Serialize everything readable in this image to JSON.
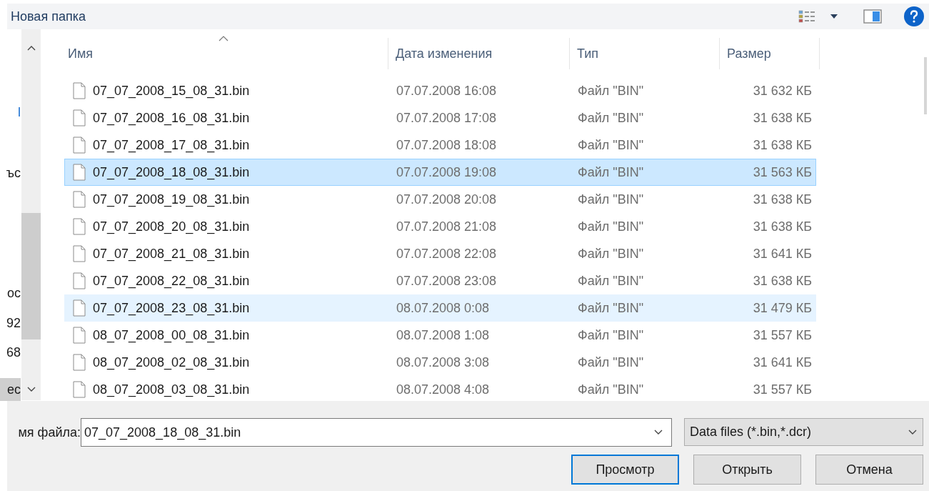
{
  "toolbar": {
    "new_folder": "Новая папка"
  },
  "nav_items": [
    {
      "label": "l",
      "kind": "link",
      "selected": false
    },
    {
      "label": "ъс",
      "kind": "text",
      "selected": false
    },
    {
      "label": "ос",
      "kind": "text",
      "selected": false
    },
    {
      "label": "92",
      "kind": "text",
      "selected": false
    },
    {
      "label": "68",
      "kind": "text",
      "selected": false
    },
    {
      "label": "ес",
      "kind": "text",
      "selected": true
    }
  ],
  "columns": [
    "Имя",
    "Дата изменения",
    "Тип",
    "Размер"
  ],
  "rows": [
    {
      "name": "07_07_2008_15_08_31.bin",
      "date": "07.07.2008 16:08",
      "type": "Файл \"BIN\"",
      "size": "31 632 КБ",
      "selected": false,
      "hovered": false
    },
    {
      "name": "07_07_2008_16_08_31.bin",
      "date": "07.07.2008 17:08",
      "type": "Файл \"BIN\"",
      "size": "31 638 КБ",
      "selected": false,
      "hovered": false
    },
    {
      "name": "07_07_2008_17_08_31.bin",
      "date": "07.07.2008 18:08",
      "type": "Файл \"BIN\"",
      "size": "31 638 КБ",
      "selected": false,
      "hovered": false
    },
    {
      "name": "07_07_2008_18_08_31.bin",
      "date": "07.07.2008 19:08",
      "type": "Файл \"BIN\"",
      "size": "31 563 КБ",
      "selected": true,
      "hovered": false
    },
    {
      "name": "07_07_2008_19_08_31.bin",
      "date": "07.07.2008 20:08",
      "type": "Файл \"BIN\"",
      "size": "31 638 КБ",
      "selected": false,
      "hovered": false
    },
    {
      "name": "07_07_2008_20_08_31.bin",
      "date": "07.07.2008 21:08",
      "type": "Файл \"BIN\"",
      "size": "31 638 КБ",
      "selected": false,
      "hovered": false
    },
    {
      "name": "07_07_2008_21_08_31.bin",
      "date": "07.07.2008 22:08",
      "type": "Файл \"BIN\"",
      "size": "31 641 КБ",
      "selected": false,
      "hovered": false
    },
    {
      "name": "07_07_2008_22_08_31.bin",
      "date": "07.07.2008 23:08",
      "type": "Файл \"BIN\"",
      "size": "31 638 КБ",
      "selected": false,
      "hovered": false
    },
    {
      "name": "07_07_2008_23_08_31.bin",
      "date": "08.07.2008 0:08",
      "type": "Файл \"BIN\"",
      "size": "31 479 КБ",
      "selected": false,
      "hovered": true
    },
    {
      "name": "08_07_2008_00_08_31.bin",
      "date": "08.07.2008 1:08",
      "type": "Файл \"BIN\"",
      "size": "31 557 КБ",
      "selected": false,
      "hovered": false
    },
    {
      "name": "08_07_2008_02_08_31.bin",
      "date": "08.07.2008 3:08",
      "type": "Файл \"BIN\"",
      "size": "31 641 КБ",
      "selected": false,
      "hovered": false
    },
    {
      "name": "08_07_2008_03_08_31.bin",
      "date": "08.07.2008 4:08",
      "type": "Файл \"BIN\"",
      "size": "31 557 КБ",
      "selected": false,
      "hovered": false
    }
  ],
  "filename": {
    "label": "мя файла:",
    "value": "07_07_2008_18_08_31.bin"
  },
  "filter": {
    "value": "Data files (*.bin,*.dcr)"
  },
  "buttons": [
    {
      "label": "Просмотр",
      "default": true
    },
    {
      "label": "Открыть",
      "default": false
    },
    {
      "label": "Отмена",
      "default": false
    }
  ]
}
